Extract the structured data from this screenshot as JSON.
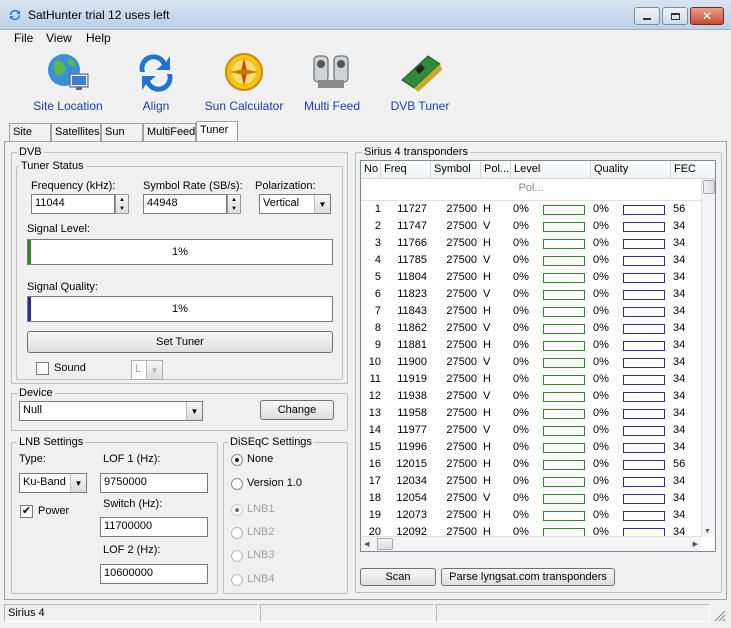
{
  "window": {
    "title": "SatHunter trial 12 uses left"
  },
  "menu": [
    "File",
    "View",
    "Help"
  ],
  "toolbar": [
    {
      "label": "Site Location",
      "icon": "globe-monitor-icon"
    },
    {
      "label": "Align",
      "icon": "arrows-refresh-icon"
    },
    {
      "label": "Sun Calculator",
      "icon": "sun-compass-icon"
    },
    {
      "label": "Multi Feed",
      "icon": "multi-lnb-icon"
    },
    {
      "label": "DVB Tuner",
      "icon": "pci-card-icon"
    }
  ],
  "tabs": [
    "Site",
    "Satellites",
    "Sun",
    "MultiFeed",
    "Tuner"
  ],
  "active_tab": "Tuner",
  "dvb": {
    "group": "DVB",
    "tuner_status": "Tuner Status",
    "frequency_label": "Frequency (kHz):",
    "frequency": "11044",
    "symbol_rate_label": "Symbol Rate (SB/s):",
    "symbol_rate": "44948",
    "polarization_label": "Polarization:",
    "polarization": "Vertical",
    "signal_level_label": "Signal Level:",
    "signal_level": "1%",
    "signal_level_value": 0.01,
    "signal_quality_label": "Signal Quality:",
    "signal_quality": "1%",
    "signal_quality_value": 0.01,
    "set_tuner": "Set Tuner",
    "sound_label": "Sound",
    "sound_channel": "L"
  },
  "device": {
    "group": "Device",
    "value": "Null",
    "change": "Change"
  },
  "lnb": {
    "group": "LNB Settings",
    "type_label": "Type:",
    "type": "Ku-Band",
    "power_label": "Power",
    "lof1_label": "LOF 1 (Hz):",
    "lof1": "9750000",
    "switch_label": "Switch (Hz):",
    "switch": "11700000",
    "lof2_label": "LOF 2 (Hz):",
    "lof2": "10600000"
  },
  "diseqc": {
    "group": "DiSEqC Settings",
    "options": [
      "None",
      "Version 1.0",
      "LNB1",
      "LNB2",
      "LNB3",
      "LNB4"
    ]
  },
  "transponders": {
    "group": "Sirius 4 transponders",
    "headers": [
      "No",
      "Freq",
      "Symbol",
      "Pol...",
      "Level",
      "Quality",
      "FEC"
    ],
    "filter_placeholder": "Pol...",
    "rows": [
      [
        "1",
        "11727",
        "27500",
        "H",
        "0%",
        "0%",
        "56"
      ],
      [
        "2",
        "11747",
        "27500",
        "V",
        "0%",
        "0%",
        "34"
      ],
      [
        "3",
        "11766",
        "27500",
        "H",
        "0%",
        "0%",
        "34"
      ],
      [
        "4",
        "11785",
        "27500",
        "V",
        "0%",
        "0%",
        "34"
      ],
      [
        "5",
        "11804",
        "27500",
        "H",
        "0%",
        "0%",
        "34"
      ],
      [
        "6",
        "11823",
        "27500",
        "V",
        "0%",
        "0%",
        "34"
      ],
      [
        "7",
        "11843",
        "27500",
        "H",
        "0%",
        "0%",
        "34"
      ],
      [
        "8",
        "11862",
        "27500",
        "V",
        "0%",
        "0%",
        "34"
      ],
      [
        "9",
        "11881",
        "27500",
        "H",
        "0%",
        "0%",
        "34"
      ],
      [
        "10",
        "11900",
        "27500",
        "V",
        "0%",
        "0%",
        "34"
      ],
      [
        "11",
        "11919",
        "27500",
        "H",
        "0%",
        "0%",
        "34"
      ],
      [
        "12",
        "11938",
        "27500",
        "V",
        "0%",
        "0%",
        "34"
      ],
      [
        "13",
        "11958",
        "27500",
        "H",
        "0%",
        "0%",
        "34"
      ],
      [
        "14",
        "11977",
        "27500",
        "V",
        "0%",
        "0%",
        "34"
      ],
      [
        "15",
        "11996",
        "27500",
        "H",
        "0%",
        "0%",
        "34"
      ],
      [
        "16",
        "12015",
        "27500",
        "H",
        "0%",
        "0%",
        "56"
      ],
      [
        "17",
        "12034",
        "27500",
        "H",
        "0%",
        "0%",
        "34"
      ],
      [
        "18",
        "12054",
        "27500",
        "V",
        "0%",
        "0%",
        "34"
      ],
      [
        "19",
        "12073",
        "27500",
        "H",
        "0%",
        "0%",
        "34"
      ],
      [
        "20",
        "12092",
        "27500",
        "H",
        "0%",
        "0%",
        "34"
      ]
    ],
    "scan": "Scan",
    "parse": "Parse lyngsat.com transponders"
  },
  "status": {
    "text": "Sirius 4"
  },
  "colors": {
    "link": "#1a3fae",
    "level": "#2a8a2a",
    "quality": "#2a2aa0"
  }
}
